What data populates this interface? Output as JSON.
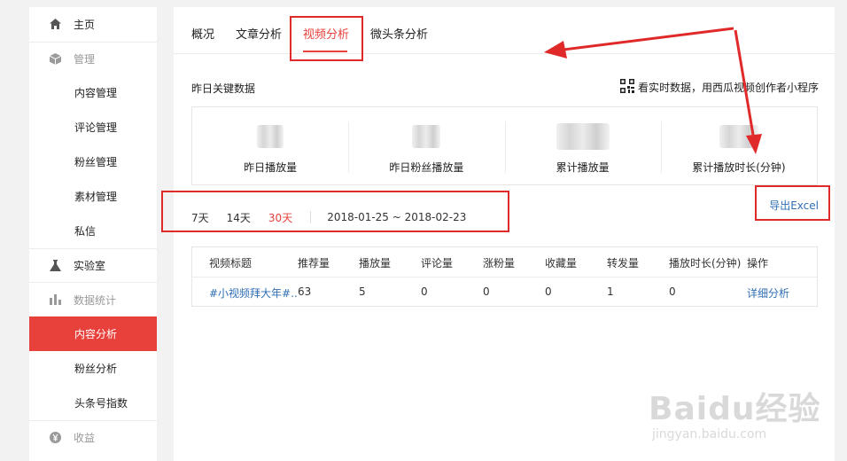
{
  "sidebar": {
    "items": [
      {
        "label": "主页",
        "icon": "home-icon",
        "kind": "top"
      },
      {
        "label": "管理",
        "icon": "cube-icon",
        "kind": "top-disabled"
      },
      {
        "label": "内容管理",
        "kind": "sub"
      },
      {
        "label": "评论管理",
        "kind": "sub"
      },
      {
        "label": "粉丝管理",
        "kind": "sub"
      },
      {
        "label": "素材管理",
        "kind": "sub"
      },
      {
        "label": "私信",
        "kind": "sub"
      },
      {
        "label": "实验室",
        "icon": "flask-icon",
        "kind": "top"
      },
      {
        "label": "数据统计",
        "icon": "bar-chart-icon",
        "kind": "top-disabled"
      },
      {
        "label": "内容分析",
        "kind": "sub-active"
      },
      {
        "label": "粉丝分析",
        "kind": "sub"
      },
      {
        "label": "头条号指数",
        "kind": "sub"
      },
      {
        "label": "收益",
        "icon": "yen-icon",
        "kind": "top-disabled"
      }
    ]
  },
  "tabs": [
    "概况",
    "文章分析",
    "视频分析",
    "微头条分析"
  ],
  "active_tab": "视频分析",
  "section": {
    "title": "昨日关键数据",
    "realtime_link": "看实时数据，用西瓜视频创作者小程序"
  },
  "stats": [
    {
      "label": "昨日播放量"
    },
    {
      "label": "昨日粉丝播放量"
    },
    {
      "label": "累计播放量"
    },
    {
      "label": "累计播放时长(分钟)"
    }
  ],
  "export_label": "导出Excel",
  "range": {
    "options": [
      "7天",
      "14天",
      "30天"
    ],
    "active": "30天",
    "date_range": "2018-01-25 ~ 2018-02-23"
  },
  "table": {
    "columns": [
      "视频标题",
      "推荐量",
      "播放量",
      "评论量",
      "涨粉量",
      "收藏量",
      "转发量",
      "播放时长(分钟)",
      "操作"
    ],
    "rows": [
      [
        "#小视频拜大年#...",
        "63",
        "5",
        "0",
        "0",
        "0",
        "1",
        "0",
        "详细分析"
      ]
    ]
  },
  "watermark": {
    "logo": "Baidu经验",
    "url": "jingyan.baidu.com"
  },
  "colors": {
    "accent": "#e8403b",
    "link": "#2f6fb5",
    "annotation": "#e02a2a"
  }
}
